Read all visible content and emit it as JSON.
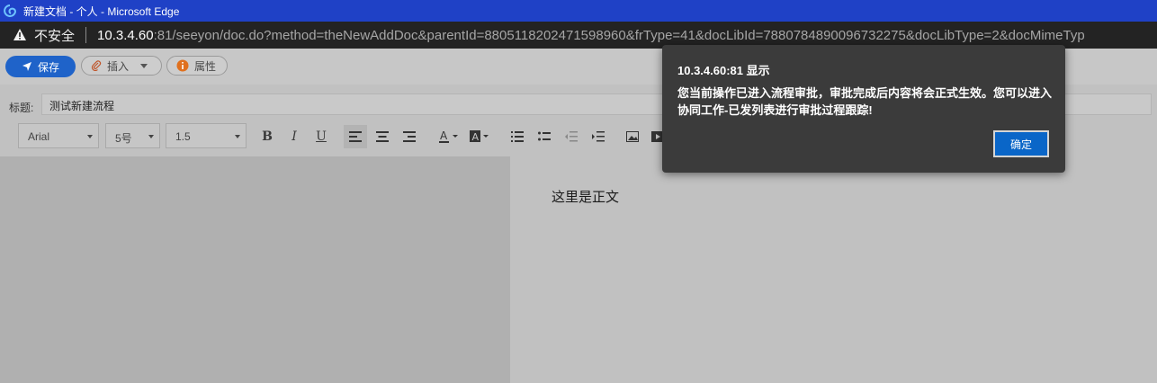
{
  "window": {
    "title": "新建文档 - 个人 - Microsoft Edge"
  },
  "address_bar": {
    "security_label": "不安全",
    "host": "10.3.4.60",
    "path": ":81/seeyon/doc.do?method=theNewAddDoc&parentId=8805118202471598960&frType=41&docLibId=7880784890096732275&docLibType=2&docMimeTyp"
  },
  "toolbar": {
    "save_label": "保存",
    "insert_label": "插入",
    "attributes_label": "属性"
  },
  "title_field": {
    "label": "标题:",
    "value": "测试新建流程"
  },
  "format_bar": {
    "font_family": "Arial",
    "font_size": "5号",
    "line_height": "1.5"
  },
  "editor": {
    "body_text": "这里是正文"
  },
  "dialog": {
    "title": "10.3.4.60:81 显示",
    "message": "您当前操作已进入流程审批，审批完成后内容将会正式生效。您可以进入协同工作-已发列表进行审批过程跟踪!",
    "ok_label": "确定"
  },
  "colors": {
    "titlebar": "#1f41c6",
    "save_button": "#1f63c9",
    "dialog_bg": "#3b3b3b",
    "ok_button": "#0a66c8"
  }
}
